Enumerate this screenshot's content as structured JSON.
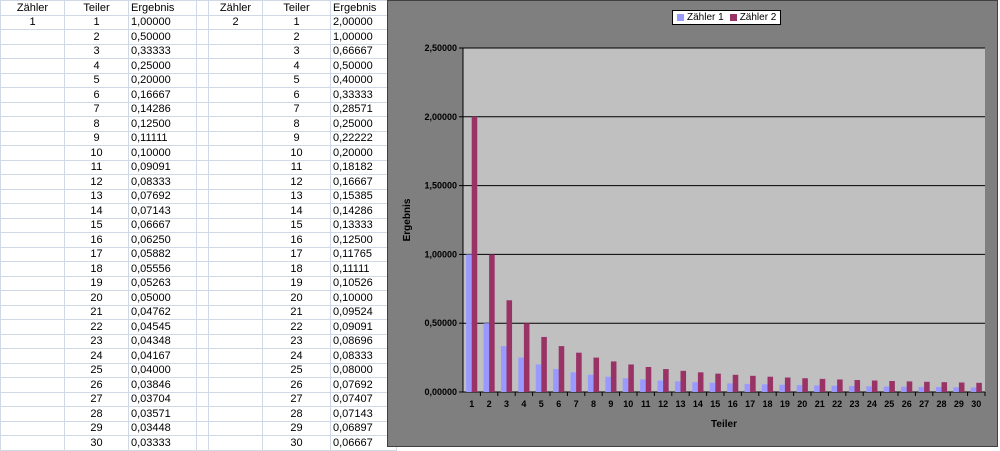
{
  "headers": [
    "Zähler",
    "Teiler",
    "Ergebnis",
    "Zähler",
    "Teiler",
    "Ergebnis"
  ],
  "left_block": {
    "zaehler": "1",
    "rows": [
      [
        "1",
        "1,00000"
      ],
      [
        "2",
        "0,50000"
      ],
      [
        "3",
        "0,33333"
      ],
      [
        "4",
        "0,25000"
      ],
      [
        "5",
        "0,20000"
      ],
      [
        "6",
        "0,16667"
      ],
      [
        "7",
        "0,14286"
      ],
      [
        "8",
        "0,12500"
      ],
      [
        "9",
        "0,11111"
      ],
      [
        "10",
        "0,10000"
      ],
      [
        "11",
        "0,09091"
      ],
      [
        "12",
        "0,08333"
      ],
      [
        "13",
        "0,07692"
      ],
      [
        "14",
        "0,07143"
      ],
      [
        "15",
        "0,06667"
      ],
      [
        "16",
        "0,06250"
      ],
      [
        "17",
        "0,05882"
      ],
      [
        "18",
        "0,05556"
      ],
      [
        "19",
        "0,05263"
      ],
      [
        "20",
        "0,05000"
      ],
      [
        "21",
        "0,04762"
      ],
      [
        "22",
        "0,04545"
      ],
      [
        "23",
        "0,04348"
      ],
      [
        "24",
        "0,04167"
      ],
      [
        "25",
        "0,04000"
      ],
      [
        "26",
        "0,03846"
      ],
      [
        "27",
        "0,03704"
      ],
      [
        "28",
        "0,03571"
      ],
      [
        "29",
        "0,03448"
      ],
      [
        "30",
        "0,03333"
      ]
    ]
  },
  "right_block": {
    "zaehler": "2",
    "rows": [
      [
        "1",
        "2,00000"
      ],
      [
        "2",
        "1,00000"
      ],
      [
        "3",
        "0,66667"
      ],
      [
        "4",
        "0,50000"
      ],
      [
        "5",
        "0,40000"
      ],
      [
        "6",
        "0,33333"
      ],
      [
        "7",
        "0,28571"
      ],
      [
        "8",
        "0,25000"
      ],
      [
        "9",
        "0,22222"
      ],
      [
        "10",
        "0,20000"
      ],
      [
        "11",
        "0,18182"
      ],
      [
        "12",
        "0,16667"
      ],
      [
        "13",
        "0,15385"
      ],
      [
        "14",
        "0,14286"
      ],
      [
        "15",
        "0,13333"
      ],
      [
        "16",
        "0,12500"
      ],
      [
        "17",
        "0,11765"
      ],
      [
        "18",
        "0,11111"
      ],
      [
        "19",
        "0,10526"
      ],
      [
        "20",
        "0,10000"
      ],
      [
        "21",
        "0,09524"
      ],
      [
        "22",
        "0,09091"
      ],
      [
        "23",
        "0,08696"
      ],
      [
        "24",
        "0,08333"
      ],
      [
        "25",
        "0,08000"
      ],
      [
        "26",
        "0,07692"
      ],
      [
        "27",
        "0,07407"
      ],
      [
        "28",
        "0,07143"
      ],
      [
        "29",
        "0,06897"
      ],
      [
        "30",
        "0,06667"
      ]
    ]
  },
  "chart_data": {
    "type": "bar",
    "xlabel": "Teiler",
    "ylabel": "Ergebnis",
    "ylim": [
      0,
      2.5
    ],
    "yticks": [
      "0,00000",
      "0,50000",
      "1,00000",
      "1,50000",
      "2,00000",
      "2,50000"
    ],
    "categories": [
      "1",
      "2",
      "3",
      "4",
      "5",
      "6",
      "7",
      "8",
      "9",
      "10",
      "11",
      "12",
      "13",
      "14",
      "15",
      "16",
      "17",
      "18",
      "19",
      "20",
      "21",
      "22",
      "23",
      "24",
      "25",
      "26",
      "27",
      "28",
      "29",
      "30"
    ],
    "series": [
      {
        "name": "Zähler 1",
        "color": "#9999ff",
        "values": [
          1.0,
          0.5,
          0.33333,
          0.25,
          0.2,
          0.16667,
          0.14286,
          0.125,
          0.11111,
          0.1,
          0.09091,
          0.08333,
          0.07692,
          0.07143,
          0.06667,
          0.0625,
          0.05882,
          0.05556,
          0.05263,
          0.05,
          0.04762,
          0.04545,
          0.04348,
          0.04167,
          0.04,
          0.03846,
          0.03704,
          0.03571,
          0.03448,
          0.03333
        ]
      },
      {
        "name": "Zähler 2",
        "color": "#993366",
        "values": [
          2.0,
          1.0,
          0.66667,
          0.5,
          0.4,
          0.33333,
          0.28571,
          0.25,
          0.22222,
          0.2,
          0.18182,
          0.16667,
          0.15385,
          0.14286,
          0.13333,
          0.125,
          0.11765,
          0.11111,
          0.10526,
          0.1,
          0.09524,
          0.09091,
          0.08696,
          0.08333,
          0.08,
          0.07692,
          0.07407,
          0.07143,
          0.06897,
          0.06667
        ]
      }
    ],
    "legend_position": "top",
    "grid": true,
    "plot_background": "#c0c0c0",
    "chart_background": "#808080"
  }
}
